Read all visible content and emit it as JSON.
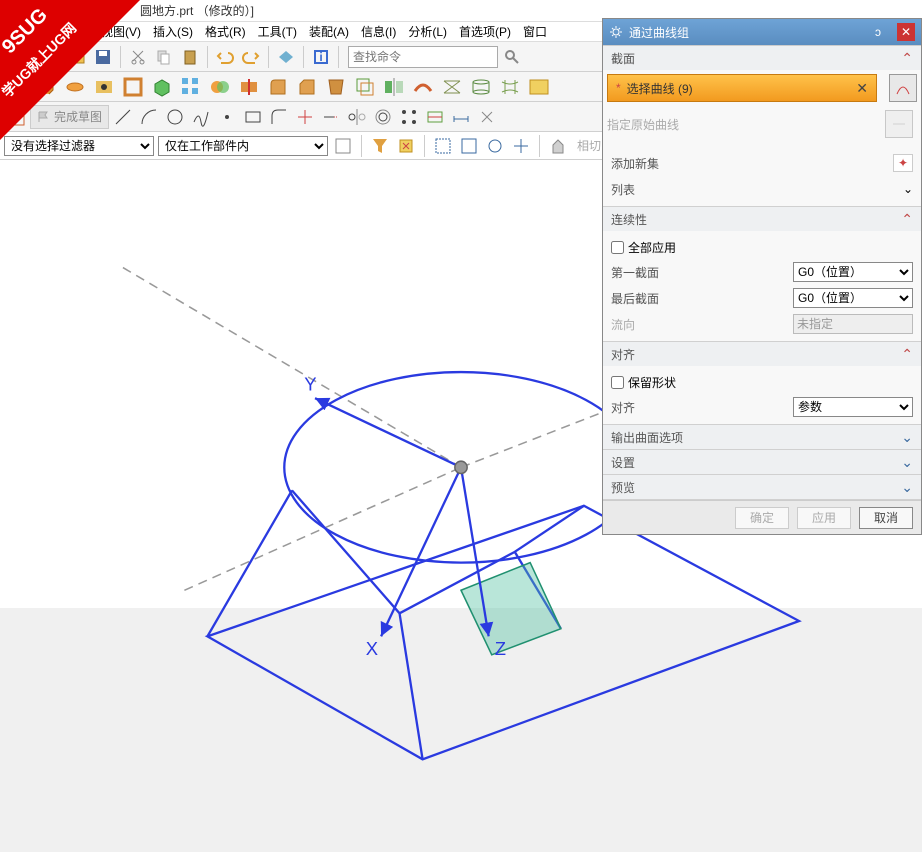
{
  "title": "圆地方.prt （修改的）]",
  "watermark": {
    "line1": "9SUG",
    "line2": "学UG就上UG网"
  },
  "menu": [
    "视图(V)",
    "插入(S)",
    "格式(R)",
    "工具(T)",
    "装配(A)",
    "信息(I)",
    "分析(L)",
    "首选项(P)",
    "窗口"
  ],
  "search_placeholder": "查找命令",
  "sketch_label": "完成草图",
  "filter": {
    "combo1": "没有选择过滤器",
    "combo2": "仅在工作部件内",
    "tail": "相切曲线"
  },
  "axes": {
    "x": "X",
    "y": "Y",
    "z": "Z"
  },
  "panel": {
    "title": "通过曲线组",
    "sections": {
      "cross": {
        "header": "截面",
        "select_curve": "选择曲线 (9)",
        "origin_curve": "指定原始曲线",
        "add_set": "添加新集",
        "list": "列表"
      },
      "continuity": {
        "header": "连续性",
        "apply_all": "全部应用",
        "first": "第一截面",
        "last": "最后截面",
        "flow": "流向",
        "opt_g0": "G0（位置）",
        "opt_none": "未指定"
      },
      "align": {
        "header": "对齐",
        "keep": "保留形状",
        "label": "对齐",
        "opt": "参数"
      },
      "output": "输出曲面选项",
      "settings": "设置",
      "preview": "预览"
    },
    "footer": {
      "ok": "确定",
      "apply": "应用",
      "cancel": "取消"
    }
  }
}
